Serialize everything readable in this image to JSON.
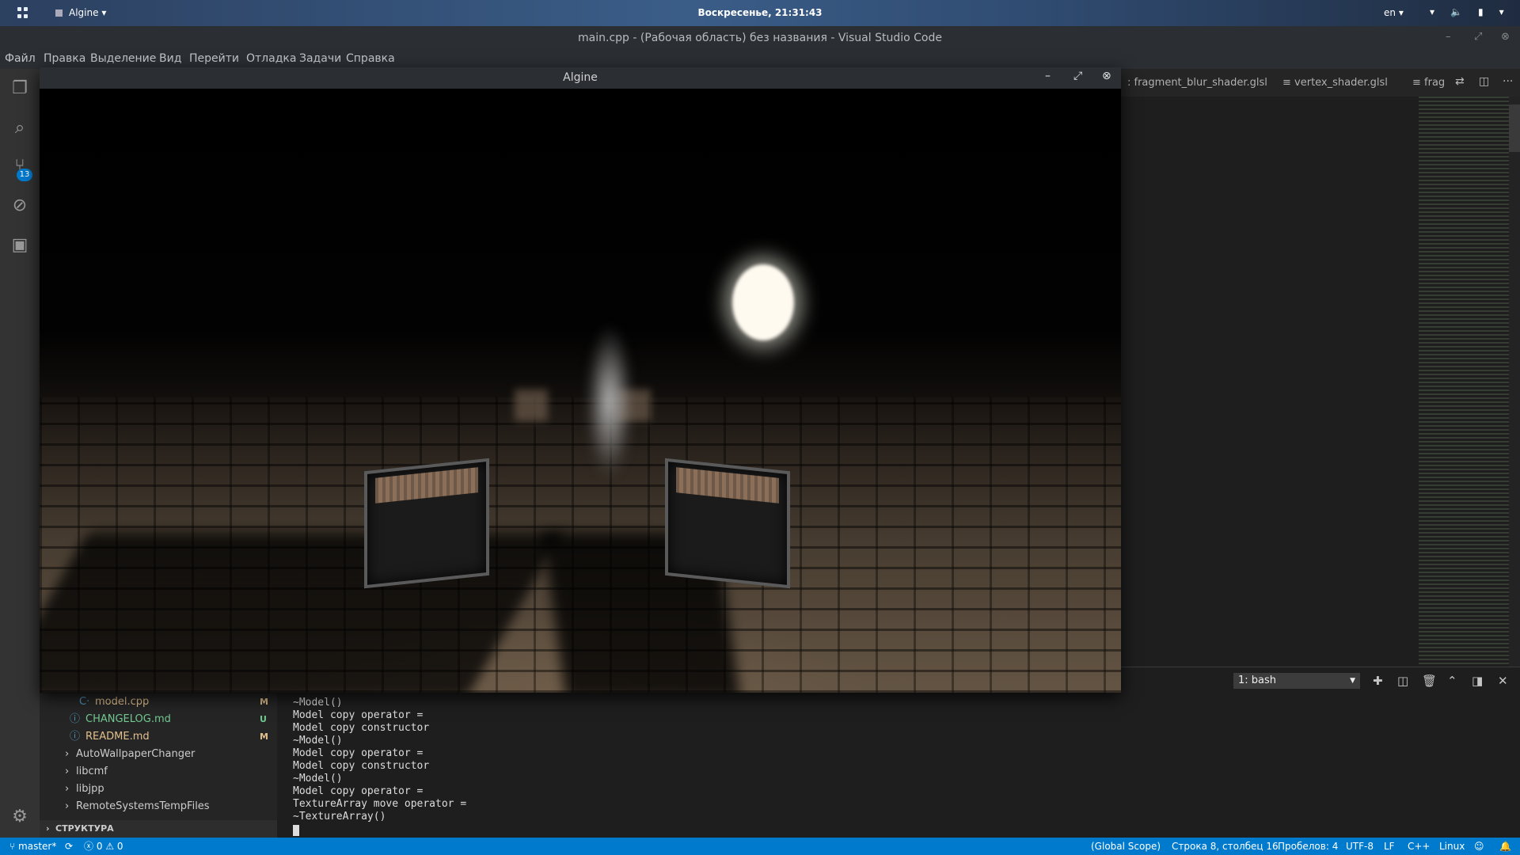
{
  "topbar": {
    "app_name": "Algine",
    "clock": "Воскресенье, 21:31:43",
    "lang": "en"
  },
  "window": {
    "title": "main.cpp - (Рабочая область) без названия - Visual Studio Code"
  },
  "menu": [
    "Файл",
    "Правка",
    "Выделение",
    "Вид",
    "Перейти",
    "Отладка",
    "Задачи",
    "Справка"
  ],
  "activity": {
    "scm_badge": "13",
    "icons": [
      "explorer-icon",
      "search-icon",
      "source-control-icon",
      "debug-icon",
      "extensions-icon",
      "gear-icon"
    ]
  },
  "sidebar": {
    "files": [
      {
        "name": "model.cpp",
        "status": "M"
      },
      {
        "name": "CHANGELOG.md",
        "status": "U"
      },
      {
        "name": "README.md",
        "status": "M"
      }
    ],
    "folders": [
      "AutoWallpaperChanger",
      "libcmf",
      "libjpp",
      "RemoteSystemsTempFiles"
    ],
    "structure": "СТРУКТУРА"
  },
  "tabs": [
    "fragment_blur_shader.glsl",
    "vertex_shader.glsl",
    "frag"
  ],
  "algine_window": {
    "title": "Algine"
  },
  "terminal": {
    "selected": "1: bash",
    "lines": [
      "~Model()",
      "Model copy operator =",
      "Model copy constructor",
      "~Model()",
      "Model copy operator =",
      "Model copy constructor",
      "~Model()",
      "Model copy operator =",
      "TextureArray move operator =",
      "~TextureArray()"
    ]
  },
  "statusbar": {
    "branch": "master*",
    "errors": "0",
    "warnings": "0",
    "scope": "(Global Scope)",
    "position": "Строка 8, столбец 16",
    "spaces": "Пробелов: 4",
    "encoding": "UTF-8",
    "eol": "LF",
    "language": "C++",
    "platform": "Linux"
  },
  "colors": {
    "statusbar_bg": "#007acc",
    "modified": "#e2c08d",
    "untracked": "#73c991"
  }
}
